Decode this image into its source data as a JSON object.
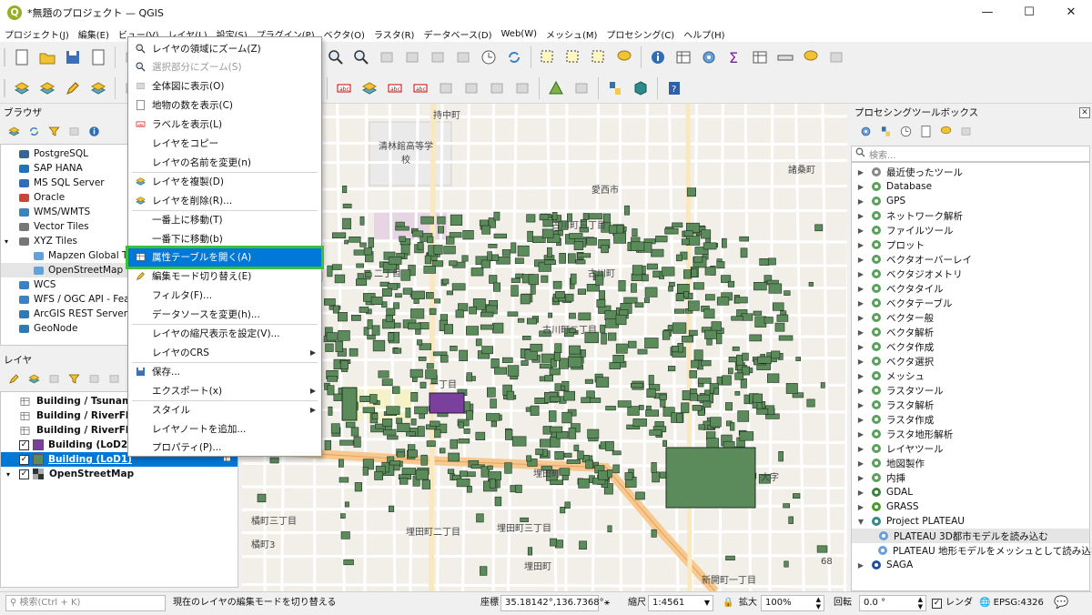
{
  "window": {
    "title": "*無題のプロジェクト — QGIS",
    "minimize": "—",
    "maximize": "☐",
    "close": "✕"
  },
  "menubar": [
    "プロジェクト(J)",
    "編集(E)",
    "ビュー(V)",
    "レイヤ(L)",
    "設定(S)",
    "プラグイン(P)",
    "ベクタ(O)",
    "ラスタ(R)",
    "データベース(D)",
    "Web(W)",
    "メッシュ(M)",
    "プロセシング(C)",
    "ヘルプ(H)"
  ],
  "browser": {
    "title": "ブラウザ",
    "items": [
      {
        "label": "PostgreSQL",
        "icon": "postgres-icon"
      },
      {
        "label": "SAP HANA",
        "icon": "hana-icon"
      },
      {
        "label": "MS SQL Server",
        "icon": "mssql-icon"
      },
      {
        "label": "Oracle",
        "icon": "oracle-icon"
      },
      {
        "label": "WMS/WMTS",
        "icon": "wms-icon"
      },
      {
        "label": "Vector Tiles",
        "icon": "vectortiles-icon"
      },
      {
        "label": "XYZ Tiles",
        "icon": "xyz-icon"
      },
      {
        "label": "Mapzen Global Terrain",
        "icon": "tile-icon"
      },
      {
        "label": "OpenStreetMap",
        "icon": "tile-icon"
      },
      {
        "label": "WCS",
        "icon": "wcs-icon"
      },
      {
        "label": "WFS / OGC API - Features",
        "icon": "wfs-icon"
      },
      {
        "label": "ArcGIS REST Servers",
        "icon": "arcgis-icon"
      },
      {
        "label": "GeoNode",
        "icon": "geonode-icon"
      }
    ]
  },
  "layers": {
    "title": "レイヤ",
    "items": [
      {
        "label": "Building / TsunamiRisk",
        "checked": false,
        "swatch": "table"
      },
      {
        "label": "Building / RiverFlood",
        "checked": false,
        "swatch": "table"
      },
      {
        "label": "Building / RiverFlood",
        "checked": false,
        "swatch": "table"
      },
      {
        "label": "Building (LoD2)",
        "checked": true,
        "swatch": "#7b3f9e"
      },
      {
        "label": "Building (LoD1)",
        "checked": true,
        "swatch": "#5b8a5b"
      },
      {
        "label": "OpenStreetMap",
        "checked": true,
        "swatch": "osm"
      }
    ],
    "check_mark": "✓",
    "collapse_mark": "▾"
  },
  "context_menu": {
    "items": [
      {
        "label": "レイヤの領域にズーム(Z)",
        "icon": "zoom-layer-icon",
        "enabled": true
      },
      {
        "label": "選択部分にズーム(S)",
        "icon": "zoom-selection-icon",
        "enabled": false
      },
      {
        "label": "全体図に表示(O)",
        "icon": "overview-icon",
        "enabled": true
      },
      {
        "label": "地物の数を表示(C)",
        "icon": "checkbox-icon",
        "enabled": true
      },
      {
        "label": "ラベルを表示(L)",
        "icon": "label-icon",
        "enabled": true
      },
      {
        "label": "レイヤをコピー",
        "icon": "",
        "enabled": true
      },
      {
        "label": "レイヤの名前を変更(n)",
        "icon": "",
        "enabled": true
      },
      {
        "label": "レイヤを複製(D)",
        "icon": "duplicate-icon",
        "enabled": true
      },
      {
        "label": "レイヤを削除(R)...",
        "icon": "remove-layer-icon",
        "enabled": true
      },
      {
        "label": "一番上に移動(T)",
        "icon": "",
        "enabled": true
      },
      {
        "label": "一番下に移動(b)",
        "icon": "",
        "enabled": true
      },
      {
        "label": "属性テーブルを開く(A)",
        "icon": "attribute-table-icon",
        "enabled": true
      },
      {
        "label": "編集モード切り替え(E)",
        "icon": "pencil-icon",
        "enabled": true
      },
      {
        "label": "フィルタ(F)...",
        "icon": "",
        "enabled": true
      },
      {
        "label": "データソースを変更(h)...",
        "icon": "",
        "enabled": true
      },
      {
        "label": "レイヤの縮尺表示を設定(V)...",
        "icon": "",
        "enabled": true
      },
      {
        "label": "レイヤのCRS",
        "icon": "",
        "enabled": true,
        "submenu": true
      },
      {
        "label": "保存...",
        "icon": "save-icon",
        "enabled": true
      },
      {
        "label": "エクスポート(x)",
        "icon": "",
        "enabled": true,
        "submenu": true
      },
      {
        "label": "スタイル",
        "icon": "",
        "enabled": true,
        "submenu": true
      },
      {
        "label": "レイヤノートを追加...",
        "icon": "",
        "enabled": true
      },
      {
        "label": "プロパティ(P)...",
        "icon": "",
        "enabled": true
      }
    ],
    "submenu_arrow": "▶"
  },
  "processing": {
    "title": "プロセシングツールボックス",
    "search_placeholder": "検索...",
    "items": [
      {
        "label": "最近使ったツール",
        "icon": "clock-icon",
        "level": 0,
        "expanded": false
      },
      {
        "label": "Database",
        "icon": "gear-icon",
        "level": 0,
        "expanded": false
      },
      {
        "label": "GPS",
        "icon": "gear-icon",
        "level": 0,
        "expanded": false
      },
      {
        "label": "ネットワーク解析",
        "icon": "gear-icon",
        "level": 0,
        "expanded": false
      },
      {
        "label": "ファイルツール",
        "icon": "gear-icon",
        "level": 0,
        "expanded": false
      },
      {
        "label": "プロット",
        "icon": "gear-icon",
        "level": 0,
        "expanded": false
      },
      {
        "label": "ベクタオーバーレイ",
        "icon": "gear-icon",
        "level": 0,
        "expanded": false
      },
      {
        "label": "ベクタジオメトリ",
        "icon": "gear-icon",
        "level": 0,
        "expanded": false
      },
      {
        "label": "ベクタタイル",
        "icon": "gear-icon",
        "level": 0,
        "expanded": false
      },
      {
        "label": "ベクタテーブル",
        "icon": "gear-icon",
        "level": 0,
        "expanded": false
      },
      {
        "label": "ベクター般",
        "icon": "gear-icon",
        "level": 0,
        "expanded": false
      },
      {
        "label": "ベクタ解析",
        "icon": "gear-icon",
        "level": 0,
        "expanded": false
      },
      {
        "label": "ベクタ作成",
        "icon": "gear-icon",
        "level": 0,
        "expanded": false
      },
      {
        "label": "ベクタ選択",
        "icon": "gear-icon",
        "level": 0,
        "expanded": false
      },
      {
        "label": "メッシュ",
        "icon": "gear-icon",
        "level": 0,
        "expanded": false
      },
      {
        "label": "ラスタツール",
        "icon": "gear-icon",
        "level": 0,
        "expanded": false
      },
      {
        "label": "ラスタ解析",
        "icon": "gear-icon",
        "level": 0,
        "expanded": false
      },
      {
        "label": "ラスタ作成",
        "icon": "gear-icon",
        "level": 0,
        "expanded": false
      },
      {
        "label": "ラスタ地形解析",
        "icon": "gear-icon",
        "level": 0,
        "expanded": false
      },
      {
        "label": "レイヤツール",
        "icon": "gear-icon",
        "level": 0,
        "expanded": false
      },
      {
        "label": "地図製作",
        "icon": "gear-icon",
        "level": 0,
        "expanded": false
      },
      {
        "label": "内挿",
        "icon": "gear-icon",
        "level": 0,
        "expanded": false
      },
      {
        "label": "GDAL",
        "icon": "gdal-icon",
        "level": 0,
        "expanded": false
      },
      {
        "label": "GRASS",
        "icon": "grass-icon",
        "level": 0,
        "expanded": false
      },
      {
        "label": "Project PLATEAU",
        "icon": "plateau-icon",
        "level": 0,
        "expanded": true
      },
      {
        "label": "PLATEAU 3D都市モデルを読み込む",
        "icon": "gear-icon",
        "level": 1,
        "expanded": false
      },
      {
        "label": "PLATEAU 地形モデルをメッシュとして読み込む",
        "icon": "gear-icon",
        "level": 1,
        "expanded": false
      },
      {
        "label": "SAGA",
        "icon": "saga-icon",
        "level": 0,
        "expanded": false
      }
    ],
    "arrow_collapsed": "▶",
    "arrow_expanded": "▼"
  },
  "map": {
    "labels": [
      "持中町",
      "清林館高等学校",
      "愛西市",
      "諸桑町",
      "古川町三丁目",
      "古川町",
      "古川町二丁目",
      "二丁目",
      "一丁目",
      "埋田町",
      "大字",
      "埋田町二丁目",
      "埋田町三丁目",
      "埋田町",
      "新開町一丁目",
      "橘町三丁目",
      "橘町3",
      "68"
    ]
  },
  "statusbar": {
    "search_placeholder": "検索(Ctrl + K)",
    "message": "現在のレイヤの編集モードを切り替える",
    "coord_label": "座標",
    "coord_value": "35.18142°,136.7368°",
    "scale_label": "縮尺",
    "scale_value": "1:4561",
    "magnify_label": "拡大",
    "magnify_value": "100%",
    "rotation_label": "回転",
    "rotation_value": "0.0 °",
    "render_label": "レンダ",
    "crs_label": "EPSG:4326"
  },
  "colors": {
    "accent": "#0078d7",
    "highlight_outline": "#3dbf3d",
    "building": "#5b8a5b",
    "building_lod2": "#7b3f9e"
  }
}
